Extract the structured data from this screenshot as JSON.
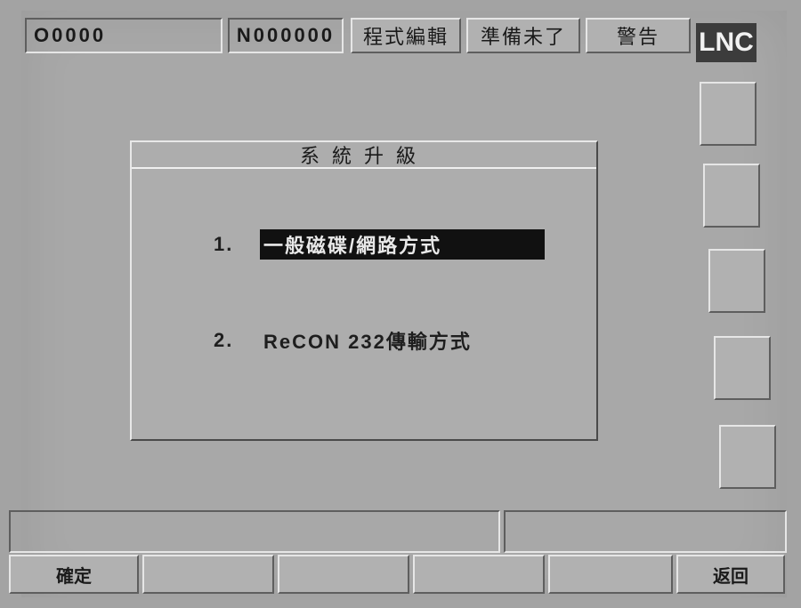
{
  "status_bar": {
    "program_number": "O0000",
    "sequence_number": "N000000",
    "mode": "程式編輯",
    "ready_status": "準備未了",
    "alarm": "警告",
    "brand": "LNC"
  },
  "dialog": {
    "title": "系統升級",
    "options": [
      {
        "number": "1.",
        "label": "一般磁碟/網路方式",
        "selected": true
      },
      {
        "number": "2.",
        "label": "ReCON 232傳輸方式",
        "selected": false
      }
    ]
  },
  "function_keys": {
    "f1": "確定",
    "f2": "",
    "f3": "",
    "f4": "",
    "f5": "",
    "f6": "返回"
  },
  "colors": {
    "screen_bg": "#a8a8a8",
    "panel": "#b1b1b1",
    "highlight_bg": "#111111",
    "highlight_text": "#e8e8e8",
    "brand_bg": "#3c3c3c"
  }
}
